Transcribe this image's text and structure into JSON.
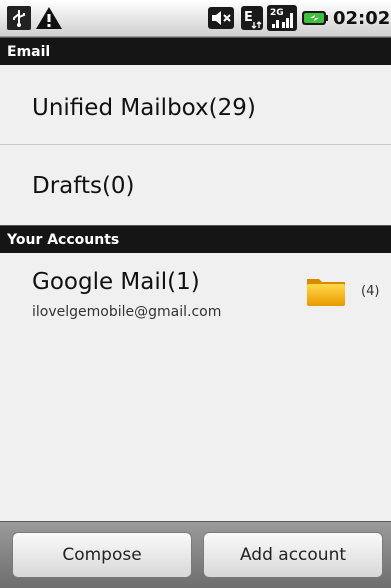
{
  "status_bar": {
    "time": "02:02",
    "icons": [
      "usb-icon",
      "warning-icon",
      "mute-icon",
      "sync-icon",
      "network-signal-icon",
      "battery-icon"
    ]
  },
  "sections": {
    "email": "Email",
    "accounts": "Your Accounts"
  },
  "mailboxes": [
    {
      "label": "Unified Mailbox(29)"
    },
    {
      "label": "Drafts(0)"
    }
  ],
  "accounts": [
    {
      "name": "Google Mail(1)",
      "email": "ilovelgemobile@gmail.com",
      "folder_count": "(4)",
      "icon": "folder-icon"
    }
  ],
  "buttons": {
    "compose": "Compose",
    "add_account": "Add account"
  },
  "colors": {
    "header_bg": "#151515",
    "list_bg": "#f0f0f0",
    "folder": "#f5b800"
  }
}
